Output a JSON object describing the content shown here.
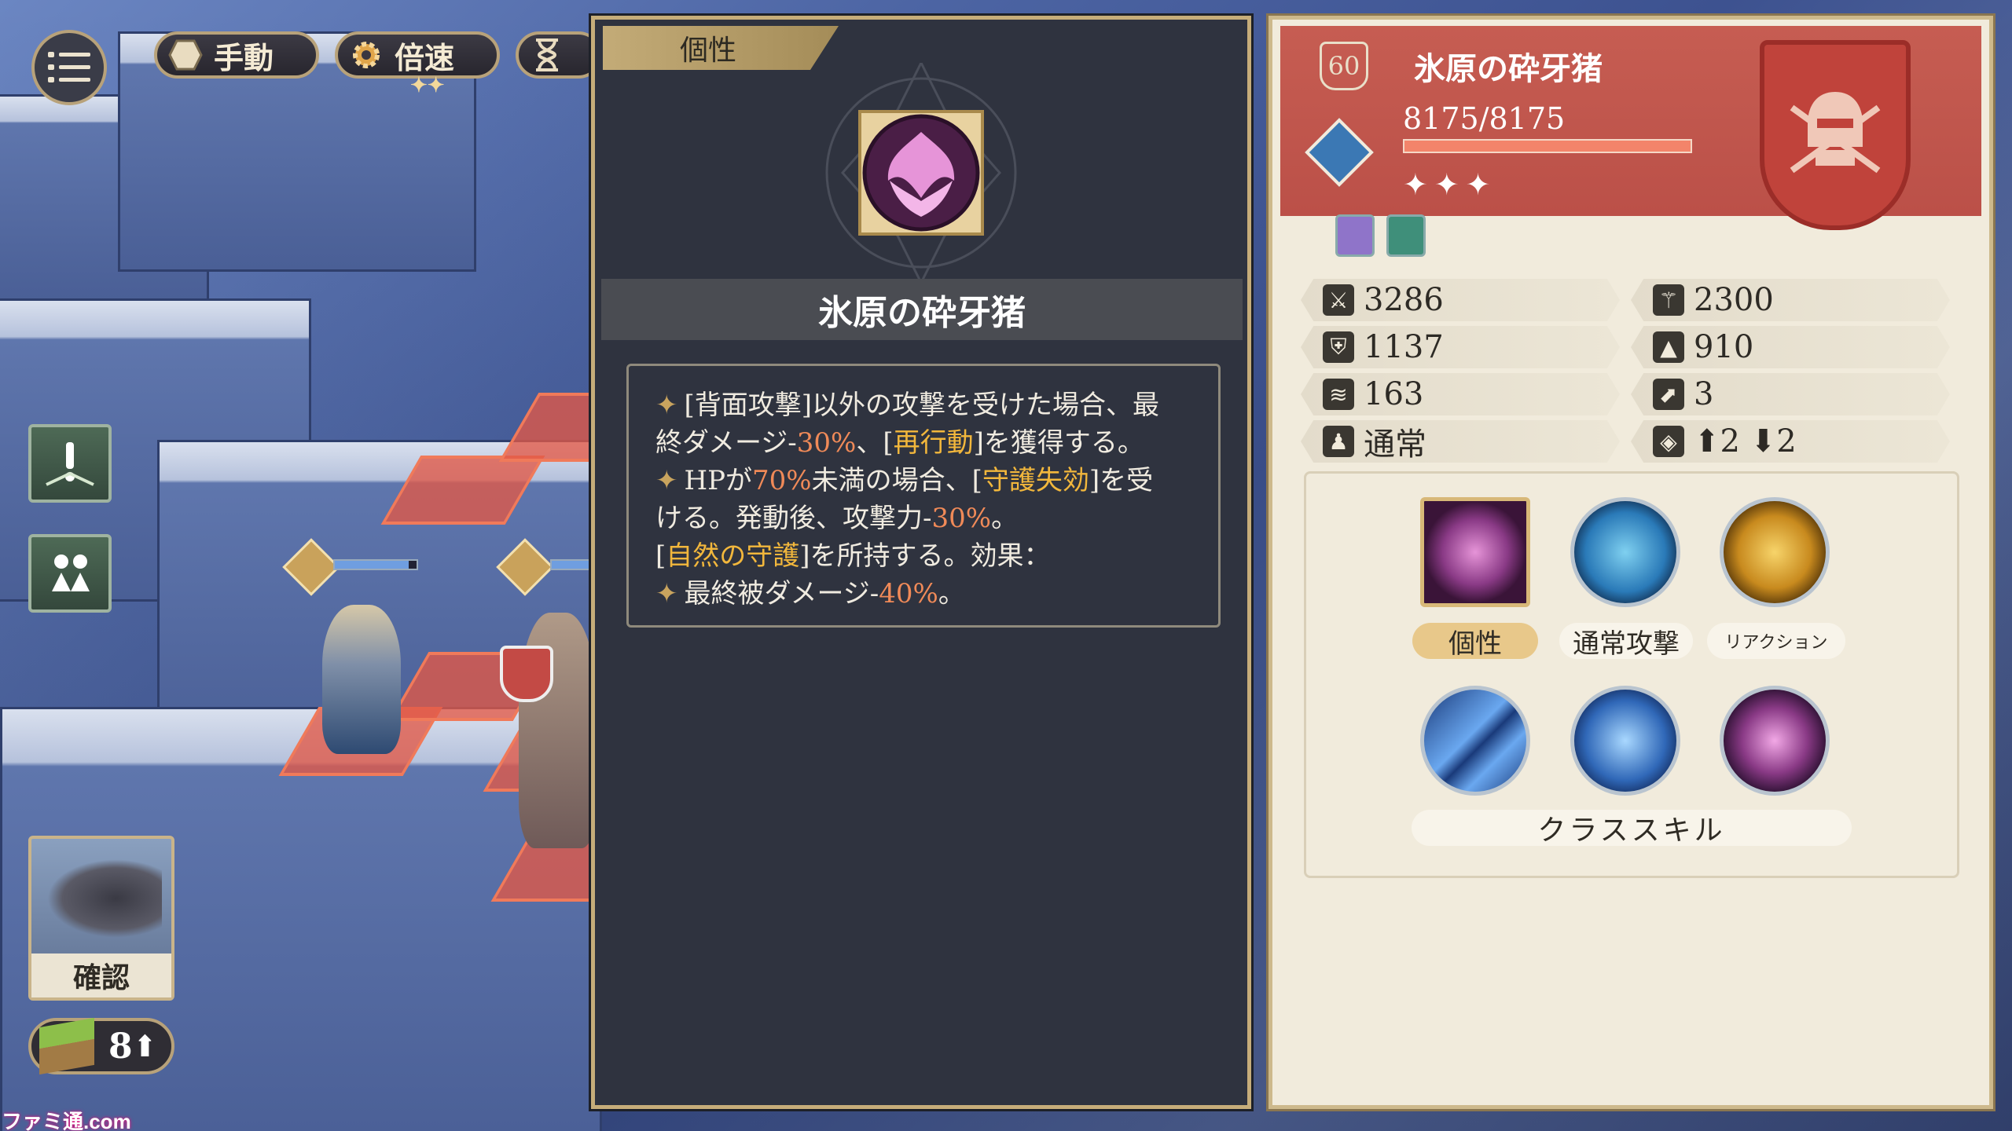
{
  "hud": {
    "mode_label": "手動",
    "speed_label": "倍速",
    "speed_stars": "✦✦"
  },
  "sidebar": {
    "confirm_label": "確認",
    "terrain_value": "8",
    "terrain_arrow": "⬆"
  },
  "watermark": "ファミ通.com",
  "detail": {
    "tab_label": "個性",
    "title": "氷原の砕牙猪",
    "desc": {
      "l1_a": "[背面攻撃]以外の攻撃を受けた場合、最",
      "l2_a": "終ダメージ-",
      "l2_b": "30%",
      "l2_c": "、[",
      "l2_d": "再行動",
      "l2_e": "]を獲得する。",
      "l3_a": "HPが",
      "l3_b": "70%",
      "l3_c": "未満の場合、[",
      "l3_d": "守護失効",
      "l3_e": "]を受",
      "l4_a": "ける。発動後、攻撃力-",
      "l4_b": "30%",
      "l4_c": "。",
      "l5_a": "[",
      "l5_b": "自然の守護",
      "l5_c": "]を所持する。効果：",
      "l6_a": "最終被ダメージ-",
      "l6_b": "40%",
      "l6_c": "。"
    }
  },
  "info": {
    "level": "60",
    "name": "氷原の砕牙猪",
    "hp_text": "8175/8175",
    "hp_fraction": 1.0,
    "stars": "✦✦✦",
    "stats": {
      "attack": "3286",
      "magic": "2300",
      "defense": "1137",
      "resistance": "910",
      "evasion": "163",
      "move": "3",
      "type": "通常",
      "jump": "⬆2 ⬇2"
    },
    "skills": {
      "trait_label": "個性",
      "normal_label": "通常攻撃",
      "reaction_label": "リアクション",
      "class_label": "クラススキル"
    }
  },
  "colors": {
    "panel_gold": "#c6ad7a",
    "accent_orange": "#f08a58",
    "accent_yellow": "#f2b73c",
    "header_red": "#c65d52"
  }
}
